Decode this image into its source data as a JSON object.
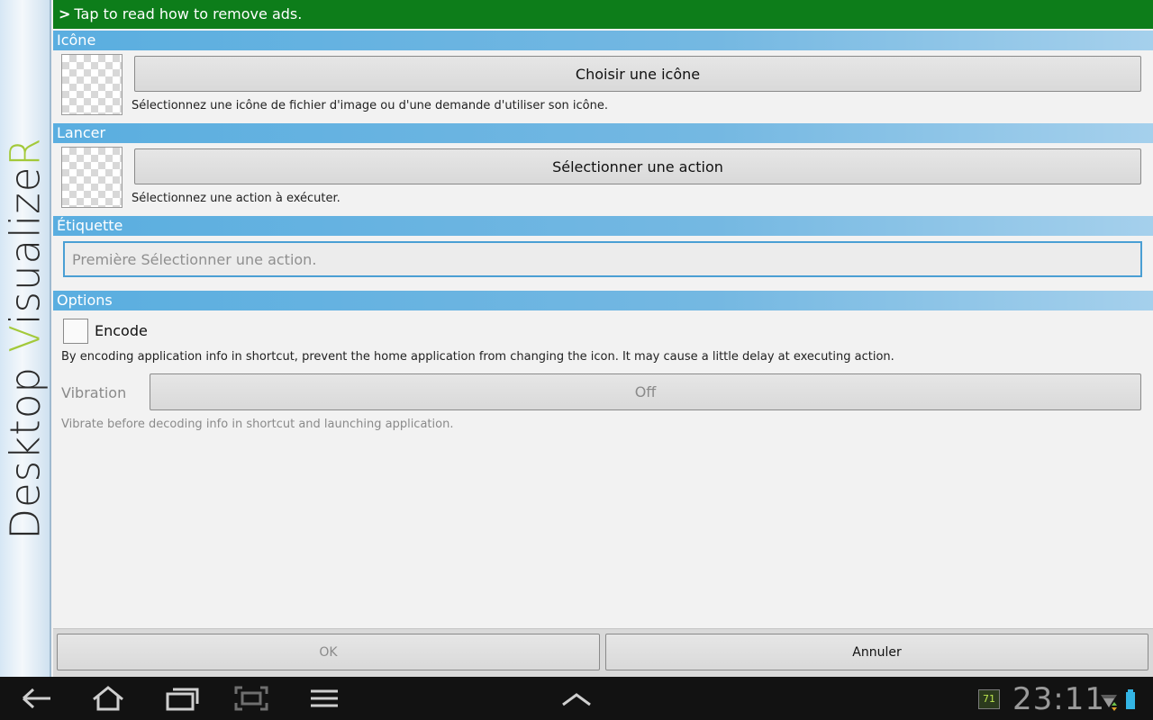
{
  "sidebar": {
    "logo_part1": "Desktop ",
    "logo_accent1": "V",
    "logo_part2": "isualize",
    "logo_accent2": "R"
  },
  "ad_banner": {
    "chevron": ">",
    "text": "Tap to read how to remove ads."
  },
  "icon_section": {
    "header": "Icône",
    "button_label": "Choisir une icône",
    "hint": "Sélectionnez une icône de fichier d'image ou d'une demande d'utiliser son icône."
  },
  "launch_section": {
    "header": "Lancer",
    "button_label": "Sélectionner une action",
    "hint": "Sélectionnez une action à exécuter."
  },
  "label_section": {
    "header": "Étiquette",
    "placeholder": "Première Sélectionner une action."
  },
  "options_section": {
    "header": "Options",
    "encode_label": "Encode",
    "encode_checked": false,
    "encode_hint": "By encoding application info in shortcut, prevent the home application from changing the icon. It may cause a little delay at executing action.",
    "vibration_label": "Vibration",
    "vibration_value": "Off",
    "vibration_hint": "Vibrate before decoding info in shortcut and launching application."
  },
  "footer": {
    "ok_label": "OK",
    "cancel_label": "Annuler"
  },
  "system_bar": {
    "notification_badge": "71",
    "clock": "23:11",
    "icons": [
      "back-icon",
      "home-icon",
      "recent-apps-icon",
      "screenshot-icon",
      "menu-icon",
      "chevron-up-icon",
      "wifi-icon",
      "battery-icon"
    ]
  },
  "colors": {
    "ad_banner": "#0d7d1a",
    "section_header": "#5aaee0",
    "logo_accent": "#a3c93a",
    "input_focus": "#4a9fd4"
  }
}
